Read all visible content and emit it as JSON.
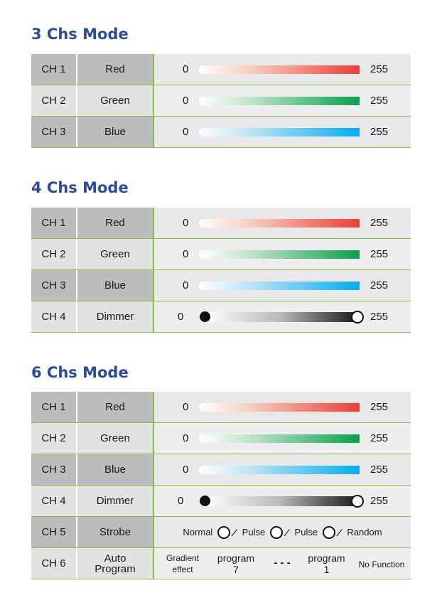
{
  "sections": [
    {
      "title": "3 Chs Mode",
      "rows": [
        {
          "ch": "CH 1",
          "name": "Red",
          "min": "0",
          "max": "255"
        },
        {
          "ch": "CH 2",
          "name": "Green",
          "min": "0",
          "max": "255"
        },
        {
          "ch": "CH 3",
          "name": "Blue",
          "min": "0",
          "max": "255"
        }
      ]
    },
    {
      "title": "4 Chs Mode",
      "rows": [
        {
          "ch": "CH 1",
          "name": "Red",
          "min": "0",
          "max": "255"
        },
        {
          "ch": "CH 2",
          "name": "Green",
          "min": "0",
          "max": "255"
        },
        {
          "ch": "CH 3",
          "name": "Blue",
          "min": "0",
          "max": "255"
        },
        {
          "ch": "CH 4",
          "name": "Dimmer",
          "min": "0",
          "max": "255"
        }
      ]
    },
    {
      "title": "6 Chs Mode",
      "rows": [
        {
          "ch": "CH 1",
          "name": "Red",
          "min": "0",
          "max": "255"
        },
        {
          "ch": "CH 2",
          "name": "Green",
          "min": "0",
          "max": "255"
        },
        {
          "ch": "CH 3",
          "name": "Blue",
          "min": "0",
          "max": "255"
        },
        {
          "ch": "CH 4",
          "name": "Dimmer",
          "min": "0",
          "max": "255"
        },
        {
          "ch": "CH 5",
          "name": "Strobe",
          "labels": [
            "Normal",
            "Pulse",
            "Pulse",
            "Random"
          ]
        },
        {
          "ch": "CH 6",
          "name_line1": "Auto",
          "name_line2": "Program",
          "gradient_line1": "Gradient",
          "gradient_line2": "effect",
          "prog7_line1": "program",
          "prog7_line2": "7",
          "dashes": "- - -",
          "prog1_line1": "program",
          "prog1_line2": "1",
          "nofunc": "No Function"
        }
      ]
    }
  ],
  "colors": {
    "title": "#2b4b9e",
    "accent_line": "#86c23f",
    "red": "#ec3d38",
    "green": "#0aa14a",
    "blue": "#04aeef"
  }
}
